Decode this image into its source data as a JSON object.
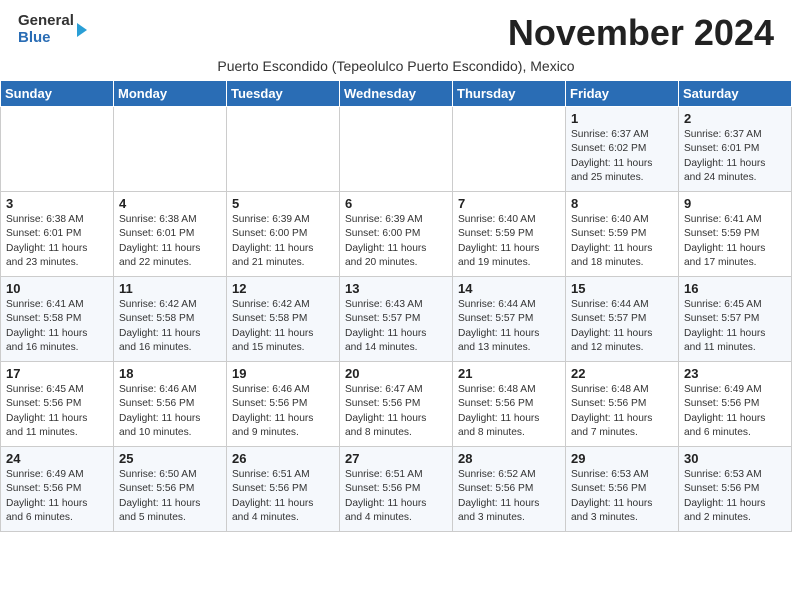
{
  "header": {
    "logo_general": "General",
    "logo_blue": "Blue",
    "month_title": "November 2024",
    "subtitle": "Puerto Escondido (Tepeolulco Puerto Escondido), Mexico"
  },
  "days_of_week": [
    "Sunday",
    "Monday",
    "Tuesday",
    "Wednesday",
    "Thursday",
    "Friday",
    "Saturday"
  ],
  "weeks": [
    [
      {
        "day": "",
        "info": ""
      },
      {
        "day": "",
        "info": ""
      },
      {
        "day": "",
        "info": ""
      },
      {
        "day": "",
        "info": ""
      },
      {
        "day": "",
        "info": ""
      },
      {
        "day": "1",
        "info": "Sunrise: 6:37 AM\nSunset: 6:02 PM\nDaylight: 11 hours\nand 25 minutes."
      },
      {
        "day": "2",
        "info": "Sunrise: 6:37 AM\nSunset: 6:01 PM\nDaylight: 11 hours\nand 24 minutes."
      }
    ],
    [
      {
        "day": "3",
        "info": "Sunrise: 6:38 AM\nSunset: 6:01 PM\nDaylight: 11 hours\nand 23 minutes."
      },
      {
        "day": "4",
        "info": "Sunrise: 6:38 AM\nSunset: 6:01 PM\nDaylight: 11 hours\nand 22 minutes."
      },
      {
        "day": "5",
        "info": "Sunrise: 6:39 AM\nSunset: 6:00 PM\nDaylight: 11 hours\nand 21 minutes."
      },
      {
        "day": "6",
        "info": "Sunrise: 6:39 AM\nSunset: 6:00 PM\nDaylight: 11 hours\nand 20 minutes."
      },
      {
        "day": "7",
        "info": "Sunrise: 6:40 AM\nSunset: 5:59 PM\nDaylight: 11 hours\nand 19 minutes."
      },
      {
        "day": "8",
        "info": "Sunrise: 6:40 AM\nSunset: 5:59 PM\nDaylight: 11 hours\nand 18 minutes."
      },
      {
        "day": "9",
        "info": "Sunrise: 6:41 AM\nSunset: 5:59 PM\nDaylight: 11 hours\nand 17 minutes."
      }
    ],
    [
      {
        "day": "10",
        "info": "Sunrise: 6:41 AM\nSunset: 5:58 PM\nDaylight: 11 hours\nand 16 minutes."
      },
      {
        "day": "11",
        "info": "Sunrise: 6:42 AM\nSunset: 5:58 PM\nDaylight: 11 hours\nand 16 minutes."
      },
      {
        "day": "12",
        "info": "Sunrise: 6:42 AM\nSunset: 5:58 PM\nDaylight: 11 hours\nand 15 minutes."
      },
      {
        "day": "13",
        "info": "Sunrise: 6:43 AM\nSunset: 5:57 PM\nDaylight: 11 hours\nand 14 minutes."
      },
      {
        "day": "14",
        "info": "Sunrise: 6:44 AM\nSunset: 5:57 PM\nDaylight: 11 hours\nand 13 minutes."
      },
      {
        "day": "15",
        "info": "Sunrise: 6:44 AM\nSunset: 5:57 PM\nDaylight: 11 hours\nand 12 minutes."
      },
      {
        "day": "16",
        "info": "Sunrise: 6:45 AM\nSunset: 5:57 PM\nDaylight: 11 hours\nand 11 minutes."
      }
    ],
    [
      {
        "day": "17",
        "info": "Sunrise: 6:45 AM\nSunset: 5:56 PM\nDaylight: 11 hours\nand 11 minutes."
      },
      {
        "day": "18",
        "info": "Sunrise: 6:46 AM\nSunset: 5:56 PM\nDaylight: 11 hours\nand 10 minutes."
      },
      {
        "day": "19",
        "info": "Sunrise: 6:46 AM\nSunset: 5:56 PM\nDaylight: 11 hours\nand 9 minutes."
      },
      {
        "day": "20",
        "info": "Sunrise: 6:47 AM\nSunset: 5:56 PM\nDaylight: 11 hours\nand 8 minutes."
      },
      {
        "day": "21",
        "info": "Sunrise: 6:48 AM\nSunset: 5:56 PM\nDaylight: 11 hours\nand 8 minutes."
      },
      {
        "day": "22",
        "info": "Sunrise: 6:48 AM\nSunset: 5:56 PM\nDaylight: 11 hours\nand 7 minutes."
      },
      {
        "day": "23",
        "info": "Sunrise: 6:49 AM\nSunset: 5:56 PM\nDaylight: 11 hours\nand 6 minutes."
      }
    ],
    [
      {
        "day": "24",
        "info": "Sunrise: 6:49 AM\nSunset: 5:56 PM\nDaylight: 11 hours\nand 6 minutes."
      },
      {
        "day": "25",
        "info": "Sunrise: 6:50 AM\nSunset: 5:56 PM\nDaylight: 11 hours\nand 5 minutes."
      },
      {
        "day": "26",
        "info": "Sunrise: 6:51 AM\nSunset: 5:56 PM\nDaylight: 11 hours\nand 4 minutes."
      },
      {
        "day": "27",
        "info": "Sunrise: 6:51 AM\nSunset: 5:56 PM\nDaylight: 11 hours\nand 4 minutes."
      },
      {
        "day": "28",
        "info": "Sunrise: 6:52 AM\nSunset: 5:56 PM\nDaylight: 11 hours\nand 3 minutes."
      },
      {
        "day": "29",
        "info": "Sunrise: 6:53 AM\nSunset: 5:56 PM\nDaylight: 11 hours\nand 3 minutes."
      },
      {
        "day": "30",
        "info": "Sunrise: 6:53 AM\nSunset: 5:56 PM\nDaylight: 11 hours\nand 2 minutes."
      }
    ]
  ]
}
